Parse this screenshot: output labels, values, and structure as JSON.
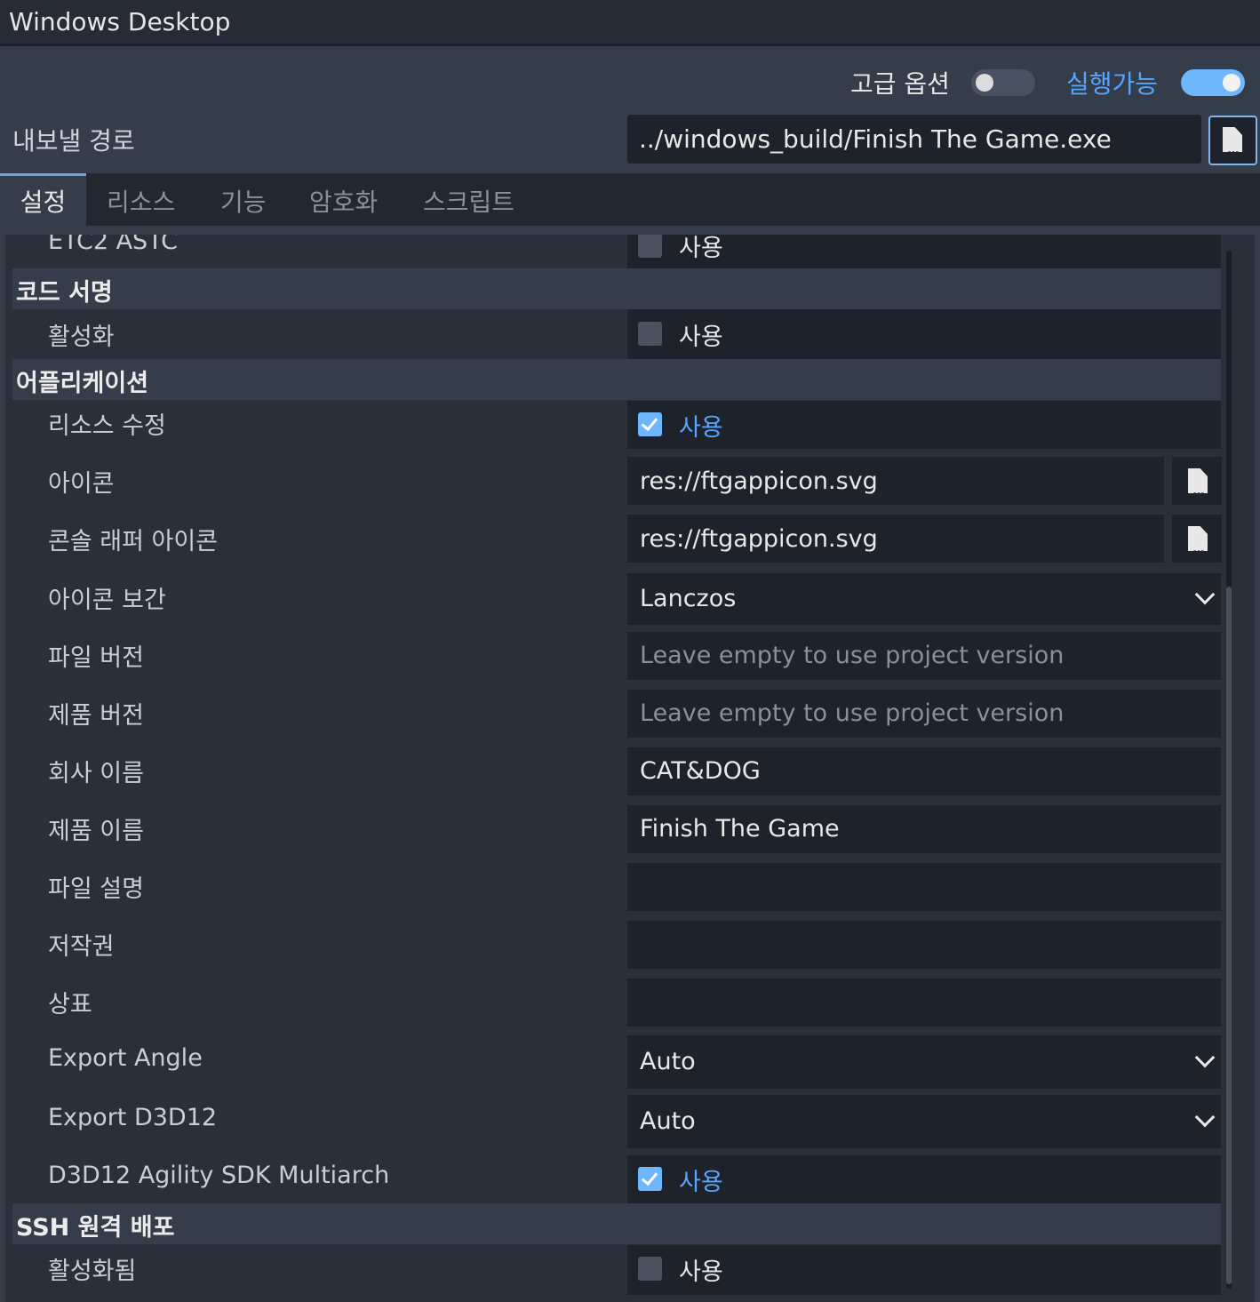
{
  "window": {
    "title": "Windows Desktop"
  },
  "top_options": {
    "advanced_label": "고급 옵션",
    "advanced_on": false,
    "runnable_label": "실행가능",
    "runnable_on": true
  },
  "export_path": {
    "label": "내보낼 경로",
    "value": "../windows_build/Finish The Game.exe"
  },
  "tabs": [
    {
      "label": "설정",
      "active": true
    },
    {
      "label": "리소스",
      "active": false
    },
    {
      "label": "기능",
      "active": false
    },
    {
      "label": "암호화",
      "active": false
    },
    {
      "label": "스크립트",
      "active": false
    }
  ],
  "enabled_text": "사용",
  "properties": {
    "etc2_astc": {
      "label": "ETC2 ASTC",
      "checked": false
    },
    "code_signing": {
      "section": "코드 서명",
      "enable": {
        "label": "활성화",
        "checked": false
      }
    },
    "application": {
      "section": "어플리케이션",
      "modify_resources": {
        "label": "리소스 수정",
        "checked": true
      },
      "icon": {
        "label": "아이콘",
        "value": "res://ftgappicon.svg"
      },
      "console_wrapper_icon": {
        "label": "콘솔 래퍼 아이콘",
        "value": "res://ftgappicon.svg"
      },
      "icon_interpolation": {
        "label": "아이콘 보간",
        "value": "Lanczos"
      },
      "file_version": {
        "label": "파일 버전",
        "placeholder": "Leave empty to use project version"
      },
      "product_version": {
        "label": "제품 버전",
        "placeholder": "Leave empty to use project version"
      },
      "company_name": {
        "label": "회사 이름",
        "value": "CAT&DOG"
      },
      "product_name": {
        "label": "제품 이름",
        "value": "Finish The Game"
      },
      "file_description": {
        "label": "파일 설명",
        "value": ""
      },
      "copyright": {
        "label": "저작권",
        "value": ""
      },
      "trademarks": {
        "label": "상표",
        "value": ""
      },
      "export_angle": {
        "label": "Export Angle",
        "value": "Auto"
      },
      "export_d3d12": {
        "label": "Export D3D12",
        "value": "Auto"
      },
      "d3d12_agility": {
        "label": "D3D12 Agility SDK Multiarch",
        "checked": true
      }
    },
    "ssh_deploy": {
      "section": "SSH 원격 배포",
      "enabled": {
        "label": "활성화됨",
        "checked": false
      }
    }
  },
  "colors": {
    "accent": "#57a5ff",
    "panel_bg": "#363d4a",
    "field_bg": "#1e222a"
  }
}
